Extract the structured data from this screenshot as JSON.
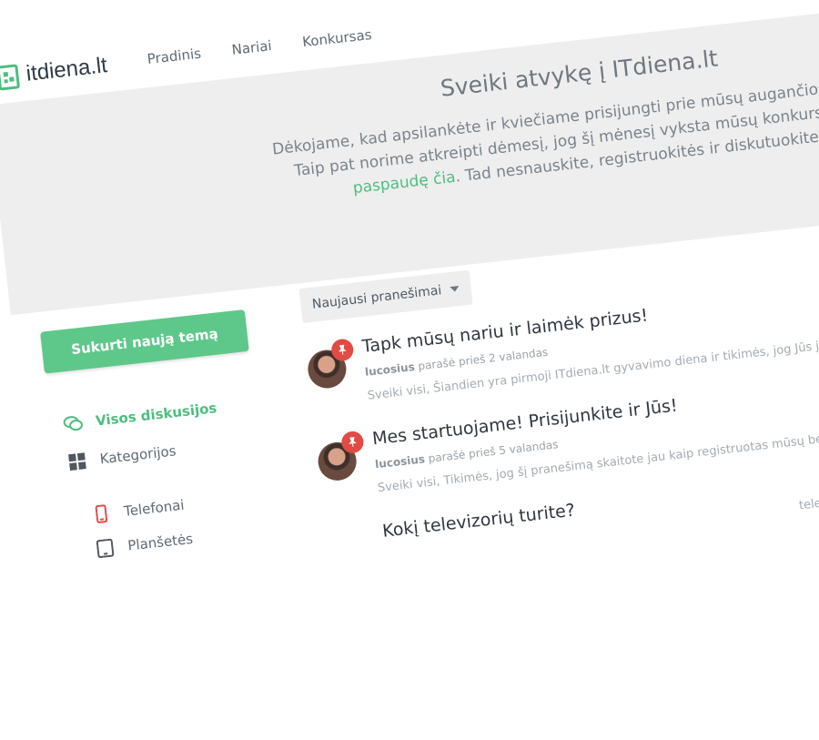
{
  "header": {
    "logo_text": "itdiena.lt",
    "nav": [
      "Pradinis",
      "Nariai",
      "Konkursas"
    ]
  },
  "hero": {
    "title": "Sveiki atvykę į ITdiena.lt",
    "line1": "Dėkojame, kad apsilankėte ir kviečiame prisijungti prie mūsų augančios bendruo",
    "line2": "Taip pat norime atkreipti dėmesį, jog šį mėnesį vyksta mūsų konkursas, kurį",
    "line3_link": "paspaudę čia",
    "line3_rest": ". Tad nesnauskite, registruokitės ir diskutuokite!"
  },
  "sidebar": {
    "create_button": "Sukurti naują temą",
    "items": [
      {
        "label": "Visos diskusijos",
        "icon": "chat-bubbles-icon",
        "active": true
      },
      {
        "label": "Kategorijos",
        "icon": "grid-icon",
        "active": false
      }
    ],
    "subitems": [
      {
        "label": "Telefonai",
        "icon": "phone-icon"
      },
      {
        "label": "Planšetės",
        "icon": "tablet-icon"
      }
    ]
  },
  "feed": {
    "sort_label": "Naujausi pranešimai",
    "posts": [
      {
        "title": "Tapk mūsų nariu ir laimėk prizus!",
        "author": "lucosius",
        "meta": "parašė prieš 2 valandas",
        "excerpt": "Sveiki visi, Šiandien yra pirmoji ITdiena.lt gyvavimo diena ir tikimės, jog Jūs jau esat"
      },
      {
        "title": "Mes startuojame! Prisijunkite ir Jūs!",
        "author": "lucosius",
        "meta": "parašė prieš 5 valandas",
        "excerpt": "Sveiki visi, Tikimės, jog šį pranešimą skaitote jau kaip registruotas mūsų bendruo"
      },
      {
        "title": "Kokį televizorių turite?",
        "author": "",
        "meta": "",
        "excerpt": "televizorių ir įsigi"
      }
    ]
  },
  "colors": {
    "accent": "#5ec88b",
    "link": "#4cbf7f",
    "pin": "#e24a44",
    "hero_bg": "#eeeeee"
  }
}
